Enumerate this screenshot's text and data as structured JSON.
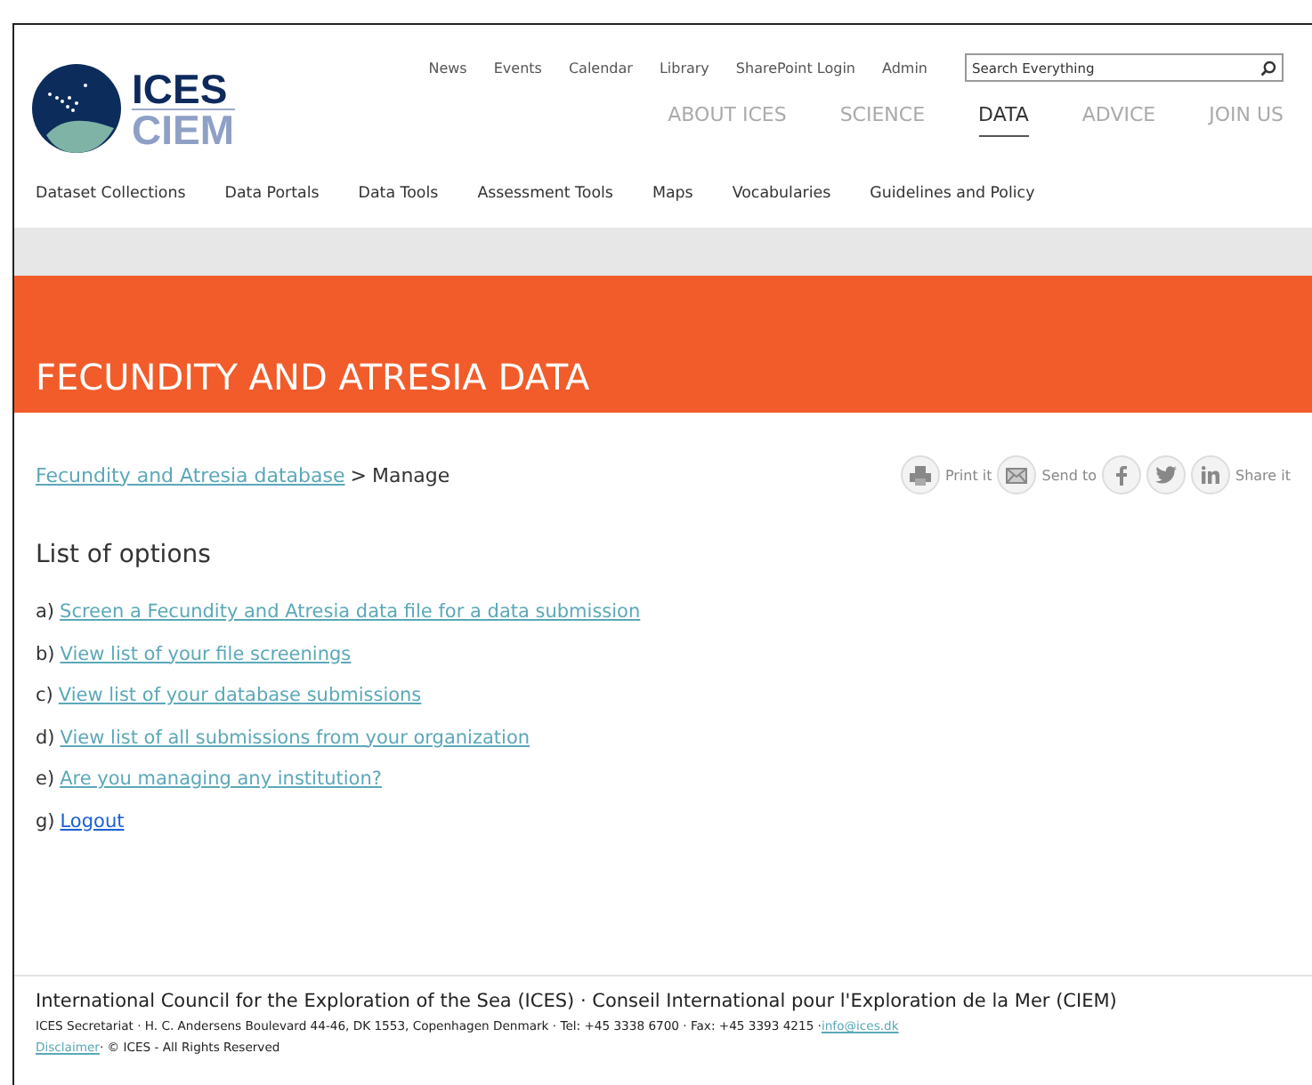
{
  "logo": {
    "top": "ICES",
    "bottom": "CIEM"
  },
  "utility_links": [
    "News",
    "Events",
    "Calendar",
    "Library",
    "SharePoint Login",
    "Admin"
  ],
  "search": {
    "placeholder": "Search Everything"
  },
  "main_nav": [
    {
      "label": "ABOUT ICES",
      "selected": false
    },
    {
      "label": "SCIENCE",
      "selected": false
    },
    {
      "label": "DATA",
      "selected": true
    },
    {
      "label": "ADVICE",
      "selected": false
    },
    {
      "label": "JOIN US",
      "selected": false
    }
  ],
  "sub_nav": [
    "Dataset Collections",
    "Data Portals",
    "Data Tools",
    "Assessment Tools",
    "Maps",
    "Vocabularies",
    "Guidelines and Policy"
  ],
  "banner": {
    "title": "FECUNDITY AND ATRESIA DATA"
  },
  "breadcrumb": {
    "link": "Fecundity and Atresia database ",
    "separator": ">",
    "current": "Manage"
  },
  "share": [
    {
      "kind": "print",
      "label": "Print it"
    },
    {
      "kind": "mail",
      "label": "Send to"
    },
    {
      "kind": "facebook"
    },
    {
      "kind": "twitter"
    },
    {
      "kind": "linkedin",
      "label": "Share it"
    }
  ],
  "options": {
    "title": "List of options",
    "items": [
      {
        "marker": "a)",
        "link": "Screen a Fecundity and Atresia data file for a data submission",
        "visited": true
      },
      {
        "marker": "b)",
        "link": "View list of your file screenings",
        "visited": true
      },
      {
        "marker": "c)",
        "link": "View list of your database submissions",
        "visited": true
      },
      {
        "marker": "d)",
        "link": "View list of all submissions from your organization",
        "visited": true
      },
      {
        "marker": "e)",
        "link": "Are you managing any institution?",
        "visited": true
      },
      {
        "marker": "g)",
        "link": "Logout",
        "visited": false
      }
    ]
  },
  "footer": {
    "title": "International Council for the Exploration of the Sea (ICES) · Conseil International pour l'Exploration de la Mer (CIEM)",
    "address": "ICES Secretariat · H. C. Andersens Boulevard 44-46, DK 1553, Copenhagen Denmark · Tel: +45 3338 6700 · Fax: +45 3393 4215 · ",
    "email": "info@ices.dk",
    "disclaimer": "Disclaimer",
    "rights": " · © ICES - All Rights Reserved"
  }
}
